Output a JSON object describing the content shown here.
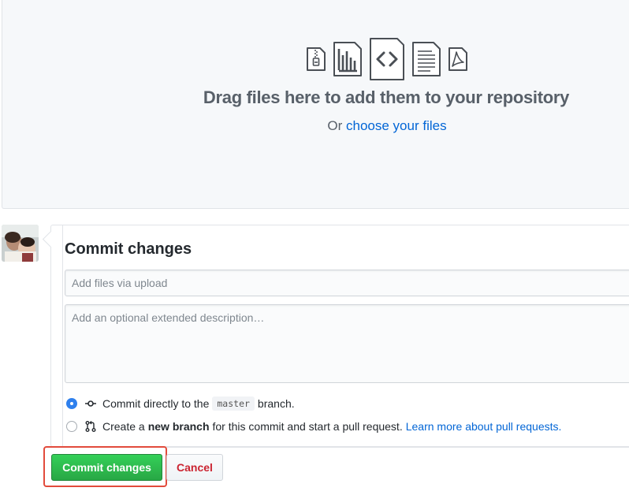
{
  "upload": {
    "file_icons": [
      "zip-file-icon",
      "chart-file-icon",
      "code-file-icon",
      "text-file-icon",
      "pdf-file-icon"
    ],
    "title": "Drag files here to add them to your repository",
    "or_prefix": "Or",
    "choose_link": "choose your files"
  },
  "commit": {
    "avatar": "user-avatar",
    "title": "Commit changes",
    "summary_placeholder": "Add files via upload",
    "description_placeholder": "Add an optional extended description…",
    "options": {
      "direct": {
        "prefix": "Commit directly to the",
        "branch": "master",
        "suffix": "branch.",
        "checked": true
      },
      "new_branch": {
        "prefix": "Create a",
        "bold": "new branch",
        "suffix": "for this commit and start a pull request.",
        "link": "Learn more about pull requests.",
        "checked": false
      }
    },
    "commit_button": "Commit changes",
    "cancel_button": "Cancel"
  },
  "colors": {
    "primary_green": "#28a745",
    "link_blue": "#0366d6",
    "cancel_red": "#cb2431",
    "highlight_red": "#e24b3c"
  }
}
